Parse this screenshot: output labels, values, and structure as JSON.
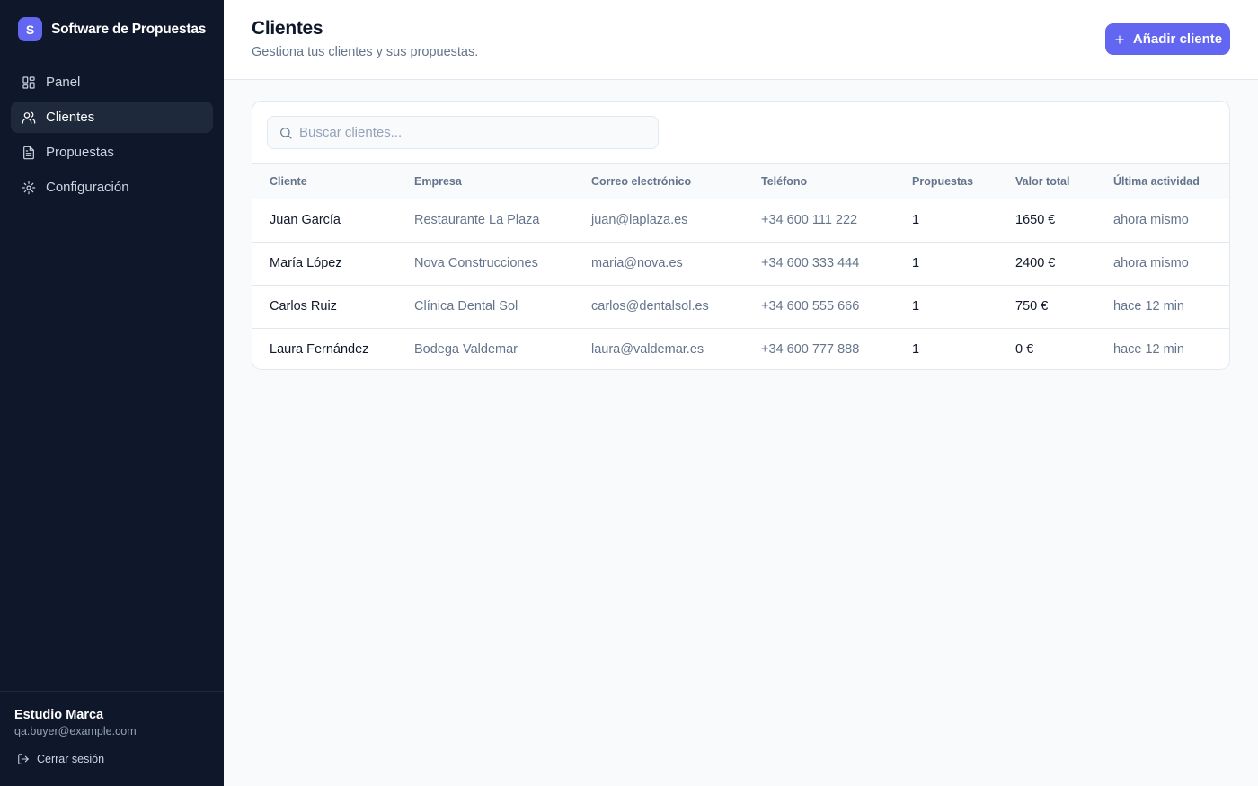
{
  "app": {
    "logo_letter": "S",
    "name": "Software de Propuestas"
  },
  "sidebar": {
    "items": [
      {
        "label": "Panel",
        "icon": "layout-grid-icon"
      },
      {
        "label": "Clientes",
        "icon": "users-icon",
        "active": true
      },
      {
        "label": "Propuestas",
        "icon": "file-text-icon"
      },
      {
        "label": "Configuración",
        "icon": "gear-icon"
      }
    ],
    "user_name": "Estudio Marca",
    "user_email": "qa.buyer@example.com",
    "logout_label": "Cerrar sesión"
  },
  "header": {
    "title": "Clientes",
    "subtitle": "Gestiona tus clientes y sus propuestas.",
    "add_button_label": "Añadir cliente"
  },
  "search": {
    "placeholder": "Buscar clientes...",
    "value": ""
  },
  "table": {
    "columns": [
      "Cliente",
      "Empresa",
      "Correo electrónico",
      "Teléfono",
      "Propuestas",
      "Valor total",
      "Última actividad"
    ],
    "rows": [
      [
        "Juan García",
        "Restaurante La Plaza",
        "juan@laplaza.es",
        "+34 600 111 222",
        "1",
        "1650 €",
        "ahora mismo"
      ],
      [
        "María López",
        "Nova Construcciones",
        "maria@nova.es",
        "+34 600 333 444",
        "1",
        "2400 €",
        "ahora mismo"
      ],
      [
        "Carlos Ruiz",
        "Clínica Dental Sol",
        "carlos@dentalsol.es",
        "+34 600 555 666",
        "1",
        "750 €",
        "hace 12 min"
      ],
      [
        "Laura Fernández",
        "Bodega Valdemar",
        "laura@valdemar.es",
        "+34 600 777 888",
        "1",
        "0 €",
        "hace 12 min"
      ]
    ]
  },
  "colors": {
    "sidebar_bg": "#0f172a",
    "accent": "#6366f1",
    "text_primary": "#0f172a",
    "text_muted": "#64748b"
  }
}
